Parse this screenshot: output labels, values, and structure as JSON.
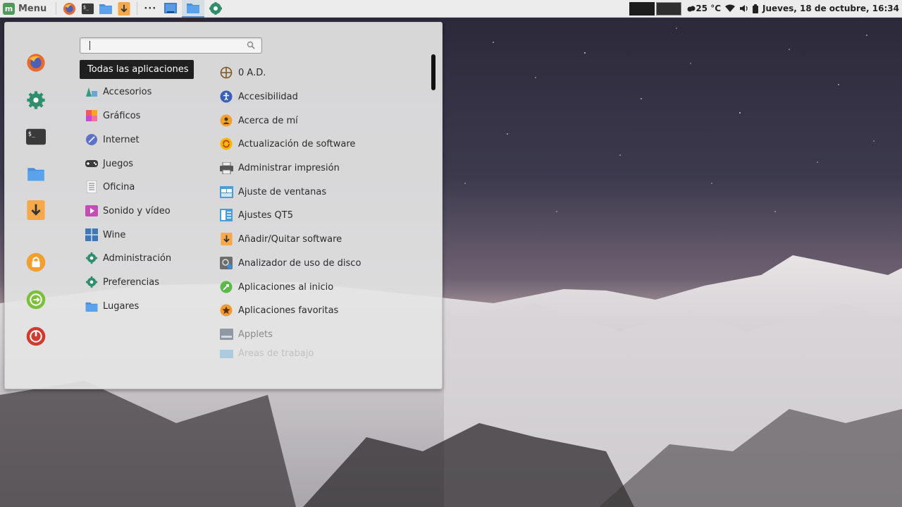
{
  "panel": {
    "menu_label": "Menu",
    "weather": "25 °C",
    "clock": "Jueves, 18 de octubre, 16:34"
  },
  "launchers": [
    {
      "icon": "firefox-icon"
    },
    {
      "icon": "terminal-icon"
    },
    {
      "icon": "files-icon"
    },
    {
      "icon": "download-icon"
    }
  ],
  "windows": [
    {
      "icon": "window-icon"
    },
    {
      "icon": "files-icon",
      "active": true
    },
    {
      "icon": "settings-icon"
    }
  ],
  "menu": {
    "search_placeholder": "",
    "favorites": [
      "firefox-icon",
      "settings-icon",
      "terminal-icon",
      "files-icon",
      "download-icon",
      "lock-icon",
      "logout-icon",
      "power-icon"
    ],
    "categories": [
      {
        "label": "Todas las aplicaciones",
        "icon": ""
      },
      {
        "label": "Accesorios",
        "icon": "accessories-icon"
      },
      {
        "label": "Gráficos",
        "icon": "graphics-icon"
      },
      {
        "label": "Internet",
        "icon": "internet-icon"
      },
      {
        "label": "Juegos",
        "icon": "games-icon"
      },
      {
        "label": "Oficina",
        "icon": "office-icon"
      },
      {
        "label": "Sonido y vídeo",
        "icon": "multimedia-icon"
      },
      {
        "label": "Wine",
        "icon": "wine-icon"
      },
      {
        "label": "Administración",
        "icon": "administration-icon"
      },
      {
        "label": "Preferencias",
        "icon": "preferences-icon"
      },
      {
        "label": "Lugares",
        "icon": "places-icon"
      }
    ],
    "apps": [
      {
        "label": "0 A.D.",
        "icon": "zero-ad-icon"
      },
      {
        "label": "Accesibilidad",
        "icon": "accessibility-icon"
      },
      {
        "label": "Acerca de mí",
        "icon": "about-me-icon"
      },
      {
        "label": "Actualización de software",
        "icon": "software-update-icon"
      },
      {
        "label": "Administrar impresión",
        "icon": "printer-icon"
      },
      {
        "label": "Ajuste de ventanas",
        "icon": "window-tiling-icon"
      },
      {
        "label": "Ajustes QT5",
        "icon": "qt5-settings-icon"
      },
      {
        "label": "Añadir/Quitar software",
        "icon": "add-remove-software-icon"
      },
      {
        "label": "Analizador de uso de disco",
        "icon": "disk-usage-icon"
      },
      {
        "label": "Aplicaciones al inicio",
        "icon": "startup-apps-icon"
      },
      {
        "label": "Aplicaciones favoritas",
        "icon": "favorite-apps-icon"
      },
      {
        "label": "Applets",
        "icon": "applets-icon"
      },
      {
        "label": "Áreas de trabajo",
        "icon": "workspaces-icon"
      }
    ]
  },
  "colors": {
    "selected_bg": "#1f1f1f",
    "panel_bg": "#ececec",
    "accent_green": "#4d9a5a"
  }
}
